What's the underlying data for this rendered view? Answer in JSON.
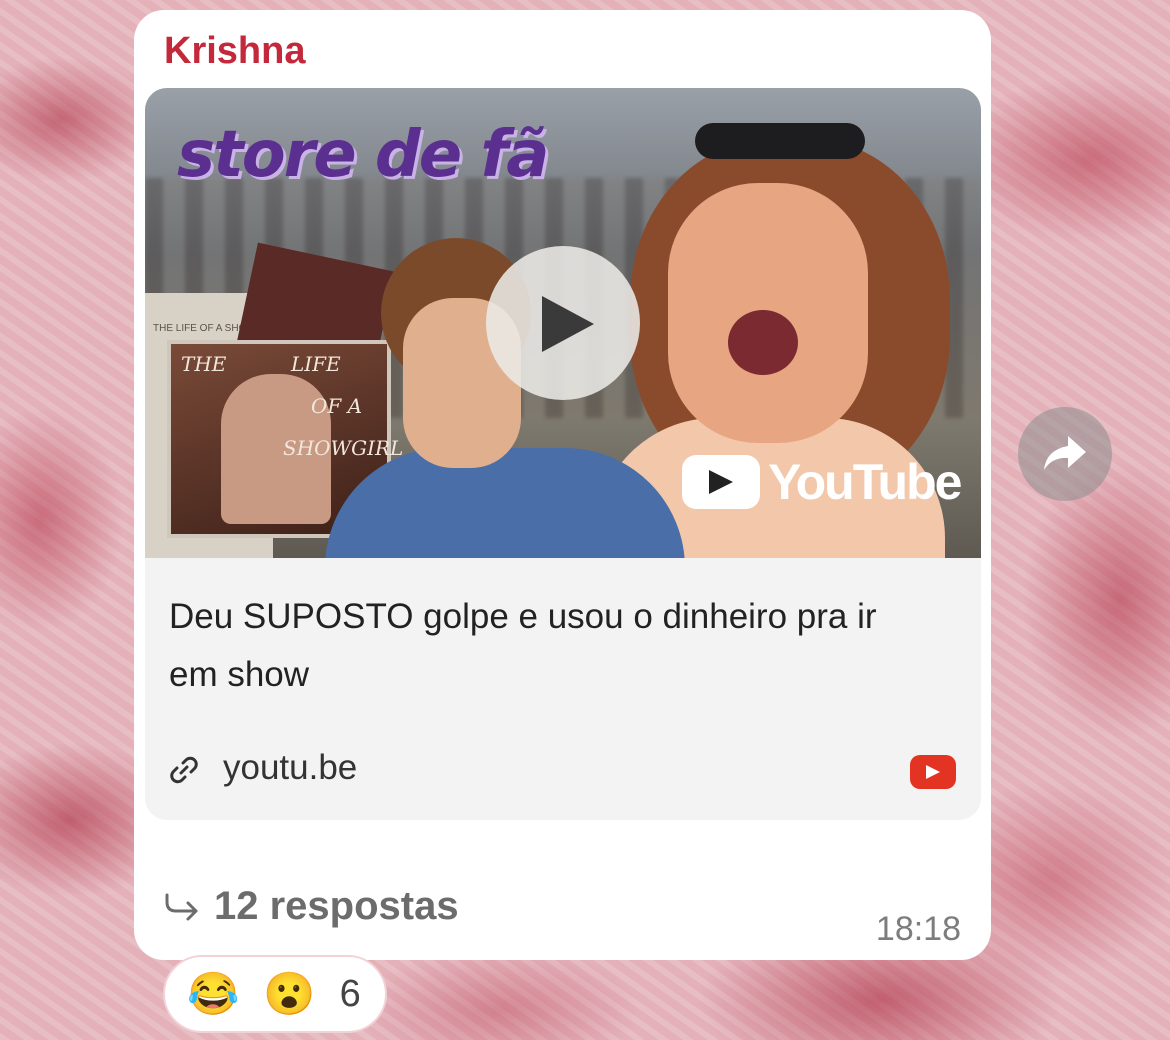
{
  "message": {
    "sender": "Krishna",
    "timestamp": "18:18",
    "replies_label": "12 respostas",
    "link_preview": {
      "title": "Deu SUPOSTO golpe e usou o dinheiro pra ir em show",
      "domain": "youtu.be",
      "thumbnail": {
        "brand_text": "store de fã",
        "album_title_lines": [
          "THE",
          "LIFE",
          "OF A",
          "SHOWGIRL"
        ],
        "album_back_text": "THE LIFE OF A SHOWGIRL",
        "watermark": "YouTube"
      }
    }
  },
  "reactions": {
    "emojis": [
      "😂",
      "😮"
    ],
    "count": "6"
  },
  "colors": {
    "sender": "#c3283b",
    "youtube_red": "#e33322"
  },
  "icons": {
    "play": "play-icon",
    "link": "link-icon",
    "youtube": "youtube-icon",
    "reply": "reply-arrow-icon",
    "forward": "forward-icon"
  }
}
